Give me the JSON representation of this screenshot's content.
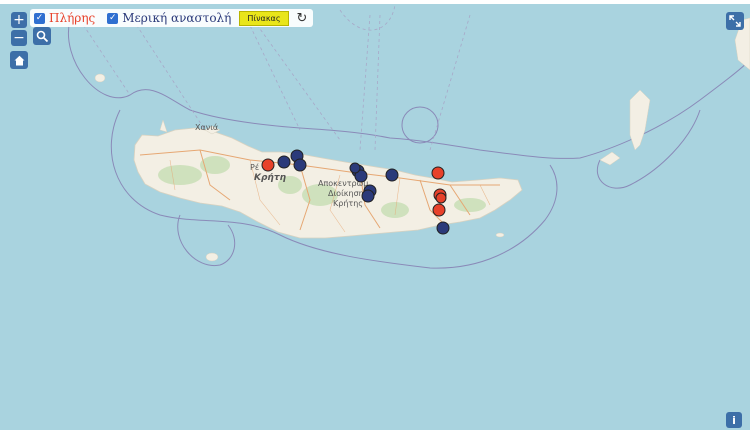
{
  "controls": {
    "zoom_in": "+",
    "zoom_out": "−",
    "search_icon": "search-icon",
    "home_icon": "home-icon",
    "fullscreen_icon": "expand-icon",
    "info": "i"
  },
  "legend": {
    "full_label": "Πλήρης",
    "partial_label": "Μερική αναστολή",
    "table_button": "Πίνακας",
    "refresh_icon": "refresh-icon",
    "full_color": "#e8412a",
    "partial_color": "#2b3a7a"
  },
  "map_labels": {
    "chania": "Χανιά",
    "rethymno": "Ρέ",
    "crete": "Κρήτη",
    "admin_line1": "Αποκεντρωμ",
    "admin_line2": "Διοίκηση",
    "admin_line3": "Κρήτης"
  },
  "markers": [
    {
      "type": "full"
    },
    {
      "type": "partial"
    },
    {
      "type": "partial"
    },
    {
      "type": "partial"
    },
    {
      "type": "partial"
    },
    {
      "type": "partial"
    },
    {
      "type": "partial"
    },
    {
      "type": "partial"
    },
    {
      "type": "partial"
    },
    {
      "type": "partial"
    },
    {
      "type": "full"
    },
    {
      "type": "full"
    },
    {
      "type": "full"
    },
    {
      "type": "full"
    },
    {
      "type": "partial"
    }
  ]
}
